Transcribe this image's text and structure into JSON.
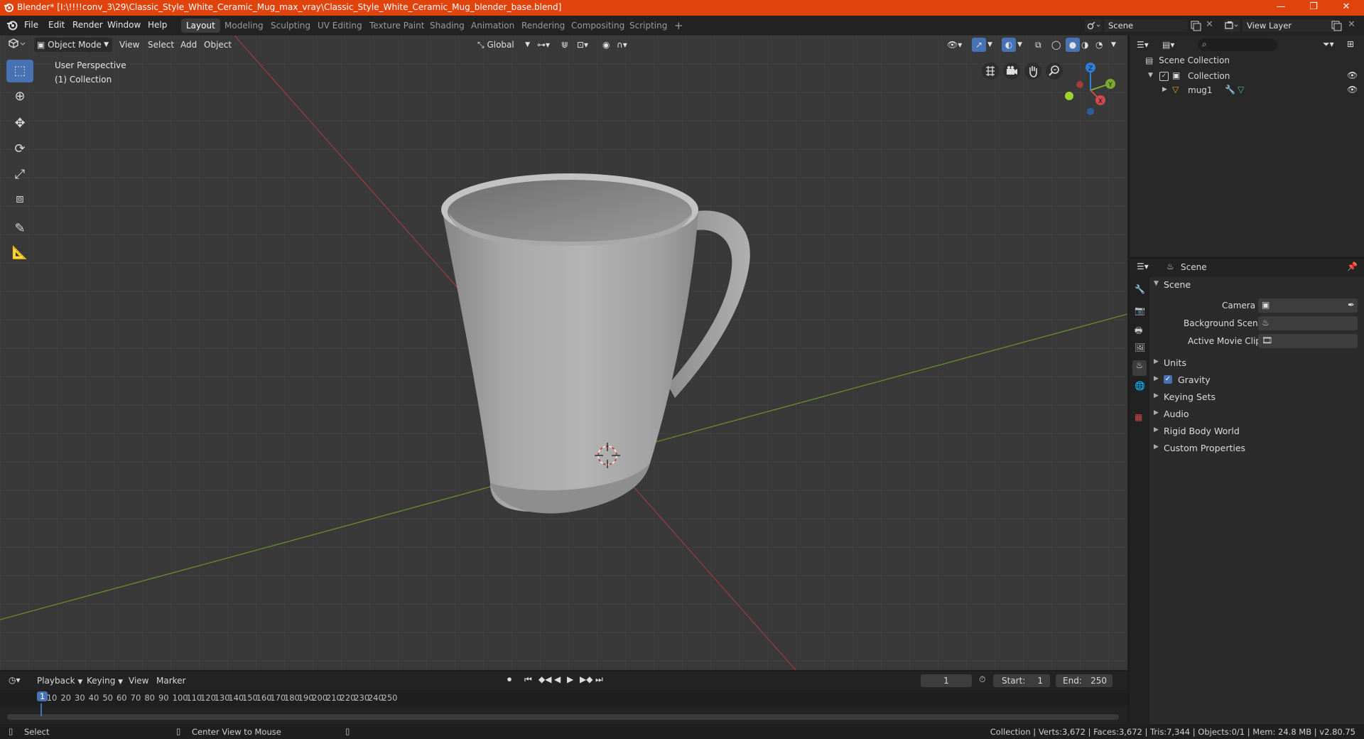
{
  "window": {
    "title": "Blender* [I:\\!!!!conv_3\\29\\Classic_Style_White_Ceramic_Mug_max_vray\\Classic_Style_White_Ceramic_Mug_blender_base.blend]",
    "controls": {
      "minimize": "—",
      "maximize": "❐",
      "close": "✕"
    }
  },
  "menu": {
    "file": "File",
    "edit": "Edit",
    "render": "Render",
    "window": "Window",
    "help": "Help"
  },
  "workspaces": [
    "Layout",
    "Modeling",
    "Sculpting",
    "UV Editing",
    "Texture Paint",
    "Shading",
    "Animation",
    "Rendering",
    "Compositing",
    "Scripting"
  ],
  "active_workspace": "Layout",
  "add_workspace": "+",
  "scene_selector": {
    "value": "Scene"
  },
  "view_layer_selector": {
    "value": "View Layer"
  },
  "viewport_header": {
    "mode": "Object Mode",
    "view": "View",
    "select": "Select",
    "add": "Add",
    "object": "Object",
    "orientation": "Global"
  },
  "viewport": {
    "perspective_label": "User Perspective",
    "collection_label": "(1) Collection",
    "gizmo": {
      "z": "Z",
      "y": "Y",
      "x": "X"
    }
  },
  "outliner": {
    "root": "Scene Collection",
    "collection": "Collection",
    "object": "mug1"
  },
  "properties": {
    "header": "Scene",
    "panel_title": "Scene",
    "camera_label": "Camera",
    "background_scene_label": "Background Scene",
    "active_movie_clip_label": "Active Movie Clip",
    "panels": [
      "Units",
      "Gravity",
      "Keying Sets",
      "Audio",
      "Rigid Body World",
      "Custom Properties"
    ],
    "gravity_checked": true
  },
  "timeline": {
    "playback": "Playback",
    "keying": "Keying",
    "view": "View",
    "marker": "Marker",
    "current_frame": "1",
    "start_label": "Start:",
    "start_value": "1",
    "end_label": "End:",
    "end_value": "250",
    "ruler": [
      "1",
      "10",
      "20",
      "30",
      "40",
      "50",
      "60",
      "70",
      "80",
      "90",
      "100",
      "110",
      "120",
      "130",
      "140",
      "150",
      "160",
      "170",
      "180",
      "190",
      "200",
      "210",
      "220",
      "230",
      "240",
      "250"
    ]
  },
  "statusbar": {
    "select": "Select",
    "center_view": "Center View to Mouse",
    "stats": "Collection | Verts:3,672 | Faces:3,672 | Tris:7,344 | Objects:0/1 | Mem: 24.8 MB | v2.80.75"
  },
  "colors": {
    "titlebar": "#e0430b",
    "accent": "#4772b3",
    "axis_x": "#d2494d",
    "axis_y": "#7bab2d",
    "axis_z": "#2e7fd9",
    "viewport_bg": "#393939"
  }
}
